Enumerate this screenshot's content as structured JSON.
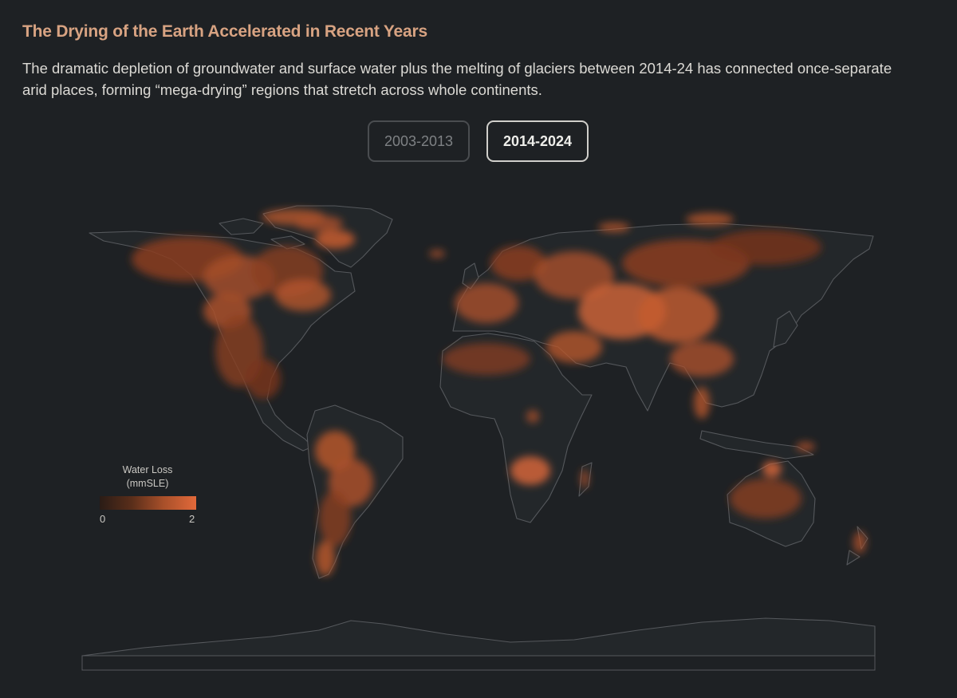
{
  "header": {
    "title": "The Drying of the Earth Accelerated in Recent Years",
    "subtitle": "The dramatic depletion of groundwater and surface water plus the melting of glaciers between 2014-24 has connected once-separate arid places, forming “mega-drying” regions that stretch across whole continents."
  },
  "period_toggle": {
    "options": [
      {
        "label": "2003-2013",
        "selected": false
      },
      {
        "label": "2014-2024",
        "selected": true
      }
    ]
  },
  "legend": {
    "title_line1": "Water Loss",
    "title_line2": "(mmSLE)",
    "min_label": "0",
    "max_label": "2",
    "color_low": "#2a1c16",
    "color_high": "#e2693a"
  },
  "map": {
    "projection": "equirectangular",
    "land_outline_color": "#55585c",
    "background_color": "#1e2124",
    "accent_color": "#d8a382"
  }
}
